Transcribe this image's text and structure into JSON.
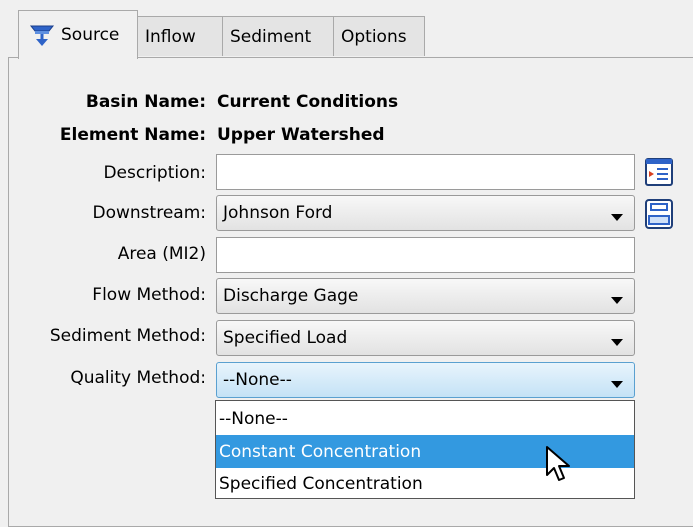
{
  "tabs": [
    {
      "label": "Source",
      "active": true,
      "icon": "source-icon"
    },
    {
      "label": "Inflow",
      "active": false
    },
    {
      "label": "Sediment",
      "active": false
    },
    {
      "label": "Options",
      "active": false
    }
  ],
  "form": {
    "basin_name_label": "Basin Name:",
    "basin_name_value": "Current Conditions",
    "element_name_label": "Element Name:",
    "element_name_value": "Upper Watershed",
    "description_label": "Description:",
    "description_value": "",
    "downstream_label": "Downstream:",
    "downstream_value": "Johnson Ford",
    "area_label": "Area (MI2)",
    "area_value": "",
    "flow_method_label": "Flow Method:",
    "flow_method_value": "Discharge Gage",
    "sediment_method_label": "Sediment Method:",
    "sediment_method_value": "Specified Load",
    "quality_method_label": "Quality Method:",
    "quality_method_value": "--None--"
  },
  "quality_dropdown": {
    "options": [
      "--None--",
      "Constant Concentration",
      "Specified Concentration"
    ],
    "highlighted": "Constant Concentration"
  },
  "icons": {
    "description_button": "description-edit-icon",
    "downstream_button": "element-select-icon"
  },
  "colors": {
    "highlight": "#3399e0",
    "combo_focus": "#c4e2f6"
  }
}
